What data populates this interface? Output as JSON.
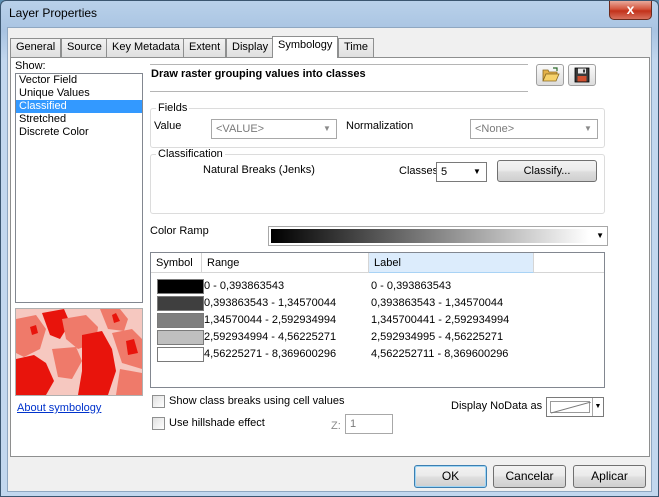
{
  "window": {
    "title": "Layer Properties",
    "close_glyph": "x"
  },
  "tabs": [
    {
      "label": "General"
    },
    {
      "label": "Source"
    },
    {
      "label": "Key Metadata"
    },
    {
      "label": "Extent"
    },
    {
      "label": "Display"
    },
    {
      "label": "Symbology",
      "active": true
    },
    {
      "label": "Time"
    }
  ],
  "show": {
    "label": "Show:",
    "items": [
      "Vector Field",
      "Unique Values",
      "Classified",
      "Stretched",
      "Discrete Color"
    ],
    "selected": "Classified"
  },
  "about_link": "About symbology",
  "heading": "Draw raster grouping values into classes",
  "toolbar_icons": {
    "open": "folder-open-icon",
    "save": "save-disk-icon"
  },
  "fields": {
    "group_label": "Fields",
    "value_label": "Value",
    "value_selected": "<VALUE>",
    "normalization_label": "Normalization",
    "normalization_selected": "<None>"
  },
  "classification": {
    "group_label": "Classification",
    "method": "Natural Breaks (Jenks)",
    "classes_label": "Classes",
    "classes_value": "5",
    "classify_button": "Classify..."
  },
  "color_ramp": {
    "label": "Color Ramp",
    "start_color": "#000000",
    "end_color": "#ffffff"
  },
  "table": {
    "headers": {
      "symbol": "Symbol",
      "range": "Range",
      "label": "Label"
    },
    "rows": [
      {
        "color": "#000000",
        "range": "0 - 0,393863543",
        "label": "0 - 0,393863543"
      },
      {
        "color": "#3f3f3f",
        "range": "0,393863543 - 1,34570044",
        "label": "0,393863543 - 1,34570044"
      },
      {
        "color": "#7f7f7f",
        "range": "1,34570044 - 2,592934994",
        "label": "1,345700441 - 2,592934994"
      },
      {
        "color": "#bfbfbf",
        "range": "2,592934994 - 4,56225271",
        "label": "2,592934995 - 4,56225271"
      },
      {
        "color": "#ffffff",
        "range": "4,56225271 - 8,369600296",
        "label": "4,562252711 - 8,369600296"
      }
    ]
  },
  "options": {
    "show_breaks_label": "Show class breaks using cell values",
    "hillshade_label": "Use hillshade effect",
    "z_label": "Z:",
    "z_value": "1",
    "nodata_label": "Display NoData as"
  },
  "buttons": {
    "ok": "OK",
    "cancel": "Cancelar",
    "apply": "Aplicar"
  },
  "colors": {
    "selection": "#3399ff",
    "link": "#0033cc",
    "preview_light": "#f6c8c0",
    "preview_mid": "#ef7a6a",
    "preview_dark": "#e8140c"
  }
}
